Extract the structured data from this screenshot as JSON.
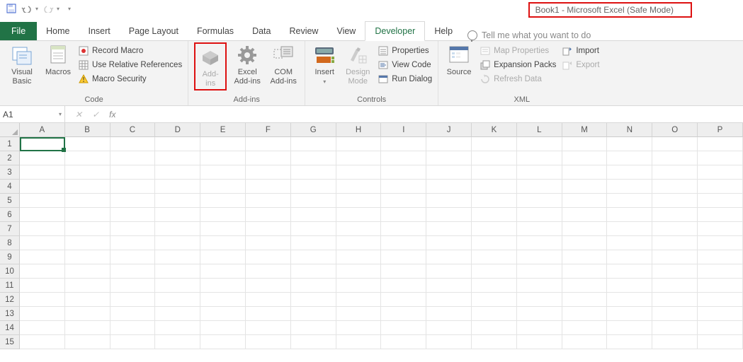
{
  "title_bar": "Book1  -  Microsoft Excel (Safe Mode)",
  "tabs": {
    "file": "File",
    "items": [
      "Home",
      "Insert",
      "Page Layout",
      "Formulas",
      "Data",
      "Review",
      "View",
      "Developer",
      "Help"
    ],
    "active": "Developer",
    "tellme": "Tell me what you want to do"
  },
  "ribbon": {
    "code": {
      "visual_basic": "Visual\nBasic",
      "macros": "Macros",
      "record_macro": "Record Macro",
      "use_relative": "Use Relative References",
      "macro_security": "Macro Security",
      "group": "Code"
    },
    "addins": {
      "addins": "Add-\nins",
      "excel_addins": "Excel\nAdd-ins",
      "com_addins": "COM\nAdd-ins",
      "group": "Add-ins"
    },
    "controls": {
      "insert": "Insert",
      "design_mode": "Design\nMode",
      "properties": "Properties",
      "view_code": "View Code",
      "run_dialog": "Run Dialog",
      "group": "Controls"
    },
    "xml": {
      "source": "Source",
      "map_properties": "Map Properties",
      "expansion_packs": "Expansion Packs",
      "refresh_data": "Refresh Data",
      "import": "Import",
      "export": "Export",
      "group": "XML"
    }
  },
  "formula_bar": {
    "name": "A1",
    "cancel": "✕",
    "enter": "✓",
    "fx": "fx"
  },
  "grid": {
    "cols": [
      "A",
      "B",
      "C",
      "D",
      "E",
      "F",
      "G",
      "H",
      "I",
      "J",
      "K",
      "L",
      "M",
      "N",
      "O",
      "P"
    ],
    "rows": [
      "1",
      "2",
      "3",
      "4",
      "5",
      "6",
      "7",
      "8",
      "9",
      "10",
      "11",
      "12",
      "13",
      "14",
      "15"
    ]
  }
}
